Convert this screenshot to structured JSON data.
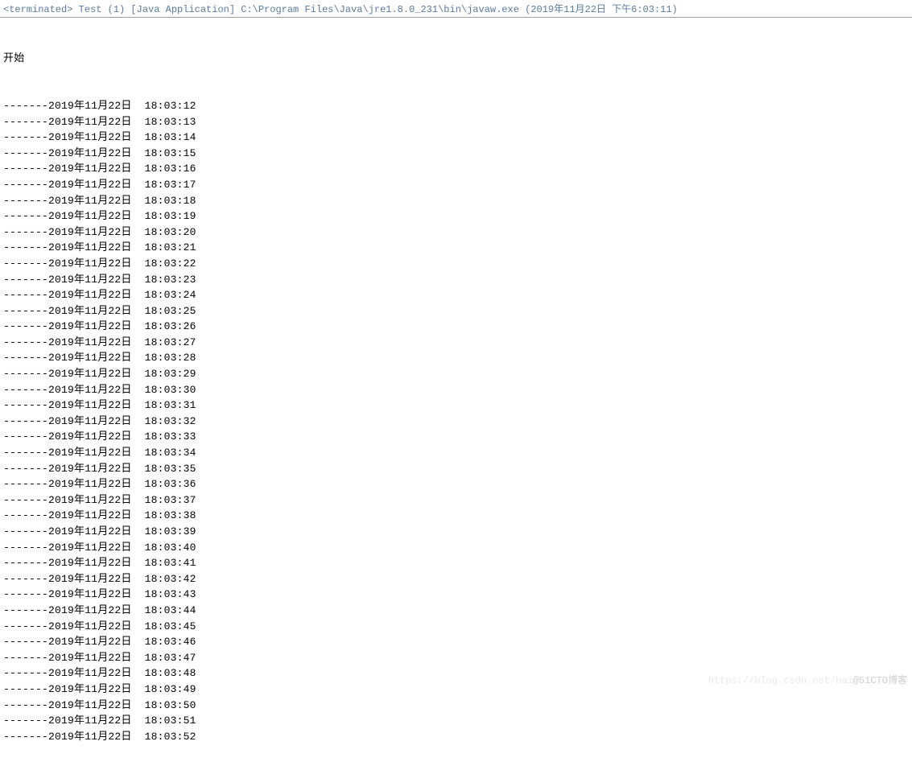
{
  "header": {
    "text": "<terminated> Test (1) [Java Application] C:\\Program Files\\Java\\jre1.8.0_231\\bin\\javaw.exe (2019年11月22日 下午6:03:11)"
  },
  "console": {
    "start_label": "开始",
    "lines": [
      "-------2019年11月22日  18:03:12",
      "-------2019年11月22日  18:03:13",
      "-------2019年11月22日  18:03:14",
      "-------2019年11月22日  18:03:15",
      "-------2019年11月22日  18:03:16",
      "-------2019年11月22日  18:03:17",
      "-------2019年11月22日  18:03:18",
      "-------2019年11月22日  18:03:19",
      "-------2019年11月22日  18:03:20",
      "-------2019年11月22日  18:03:21",
      "-------2019年11月22日  18:03:22",
      "-------2019年11月22日  18:03:23",
      "-------2019年11月22日  18:03:24",
      "-------2019年11月22日  18:03:25",
      "-------2019年11月22日  18:03:26",
      "-------2019年11月22日  18:03:27",
      "-------2019年11月22日  18:03:28",
      "-------2019年11月22日  18:03:29",
      "-------2019年11月22日  18:03:30",
      "-------2019年11月22日  18:03:31",
      "-------2019年11月22日  18:03:32",
      "-------2019年11月22日  18:03:33",
      "-------2019年11月22日  18:03:34",
      "-------2019年11月22日  18:03:35",
      "-------2019年11月22日  18:03:36",
      "-------2019年11月22日  18:03:37",
      "-------2019年11月22日  18:03:38",
      "-------2019年11月22日  18:03:39",
      "-------2019年11月22日  18:03:40",
      "-------2019年11月22日  18:03:41",
      "-------2019年11月22日  18:03:42",
      "-------2019年11月22日  18:03:43",
      "-------2019年11月22日  18:03:44",
      "-------2019年11月22日  18:03:45",
      "-------2019年11月22日  18:03:46",
      "-------2019年11月22日  18:03:47",
      "-------2019年11月22日  18:03:48",
      "-------2019年11月22日  18:03:49",
      "-------2019年11月22日  18:03:50",
      "-------2019年11月22日  18:03:51",
      "-------2019年11月22日  18:03:52"
    ]
  },
  "watermark": {
    "faint": "https://blog.csdn.net/bai",
    "text": "@51CTO博客"
  }
}
